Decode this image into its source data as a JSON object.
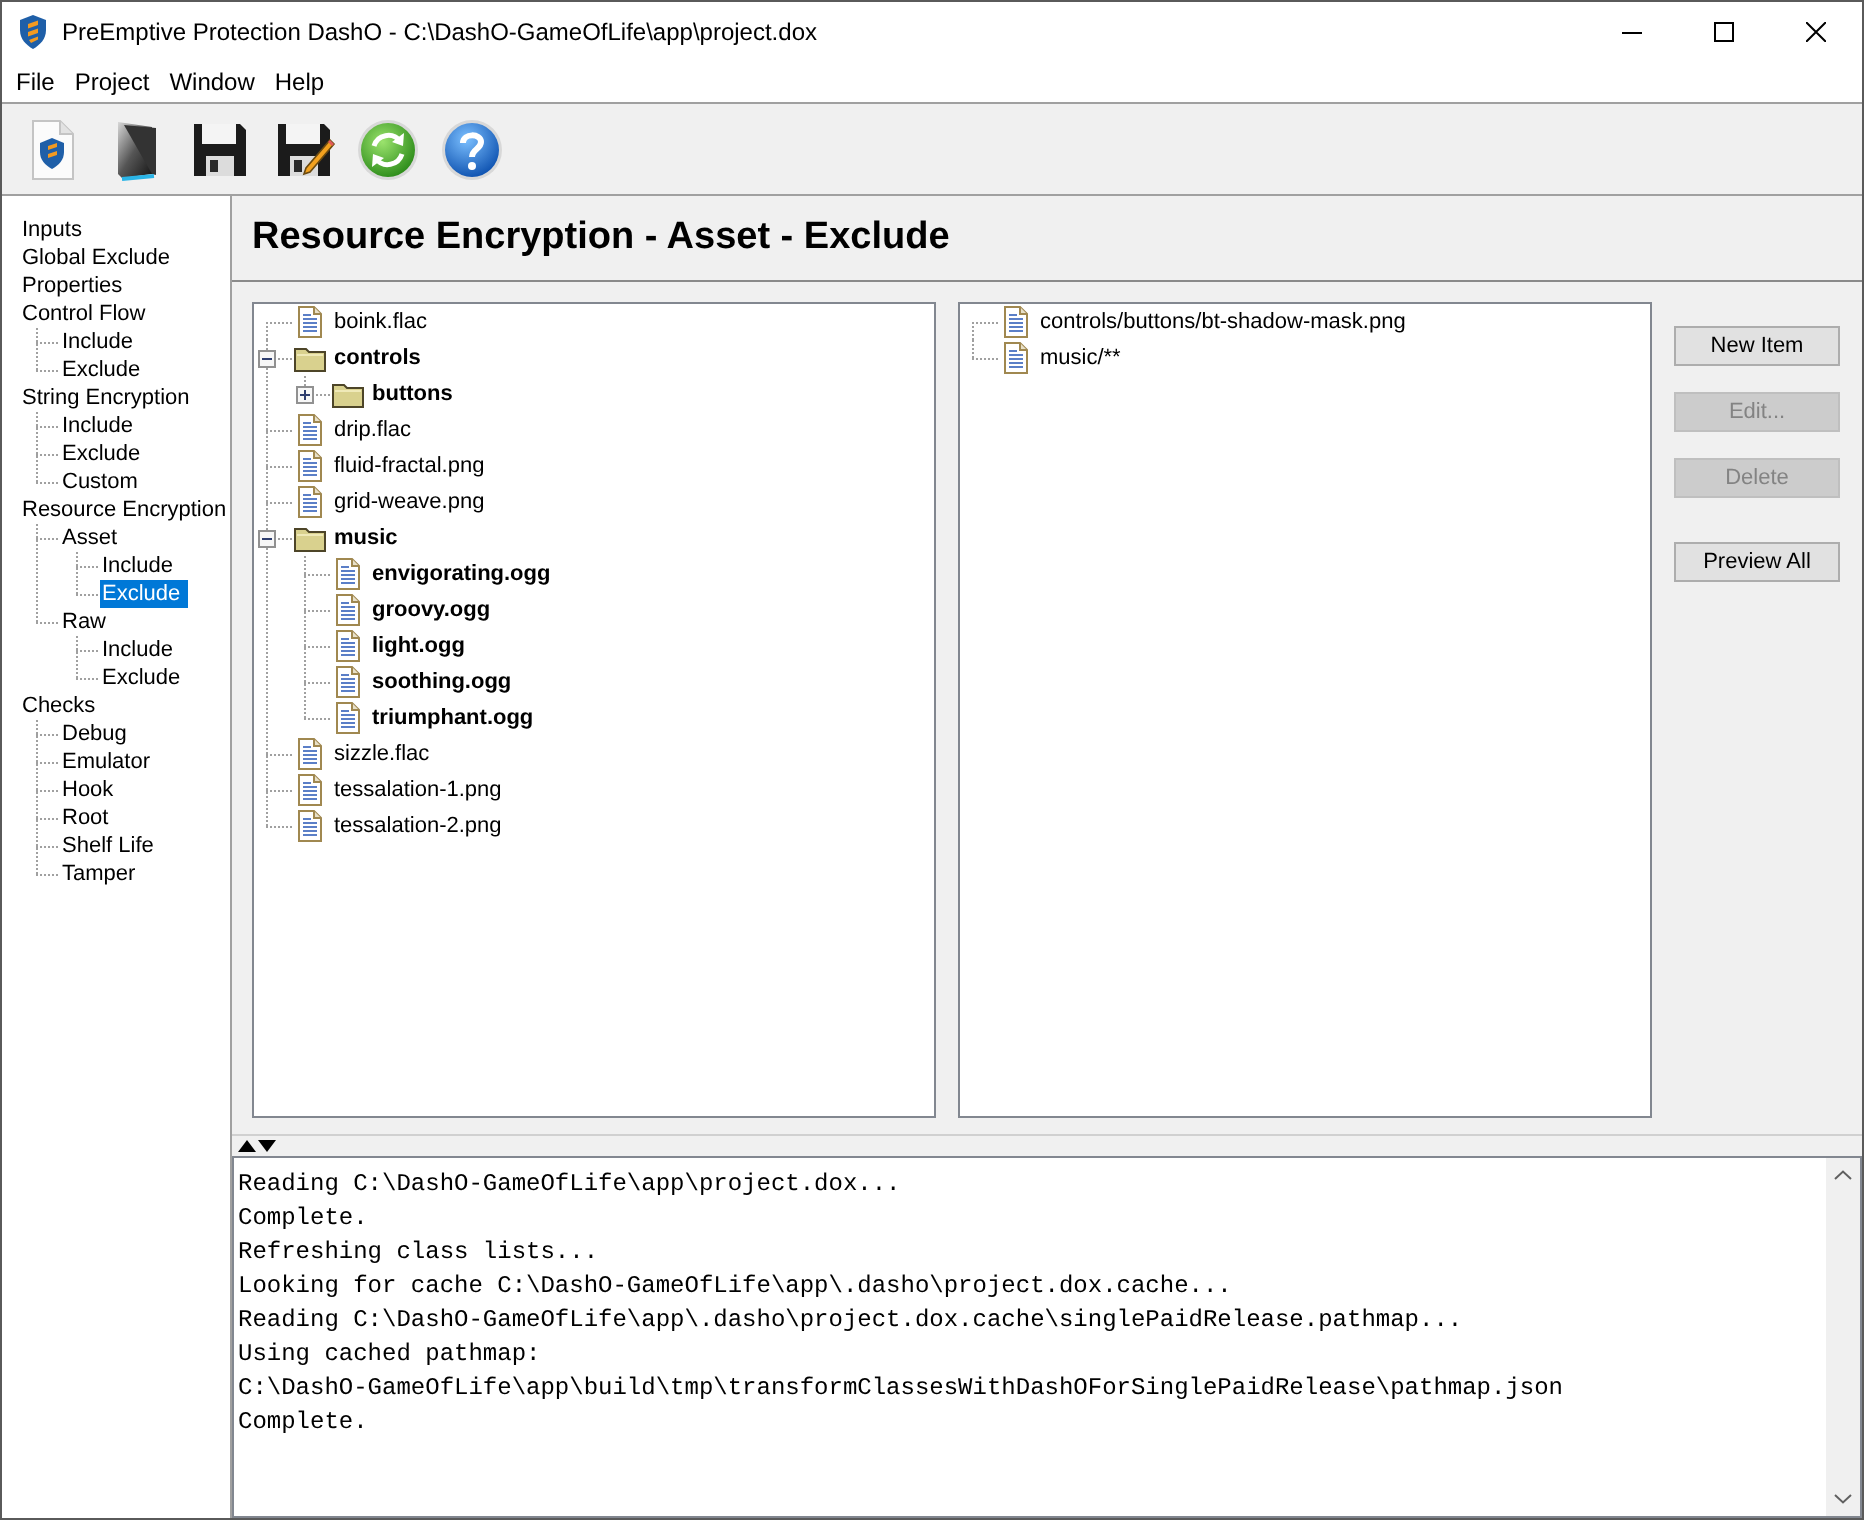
{
  "window": {
    "title": "PreEmptive Protection DashO - C:\\DashO-GameOfLife\\app\\project.dox"
  },
  "menu": [
    "File",
    "Project",
    "Window",
    "Help"
  ],
  "sidebar": {
    "items": [
      {
        "label": "Inputs",
        "selected": false
      },
      {
        "label": "Global Exclude",
        "selected": false
      },
      {
        "label": "Properties",
        "selected": false
      },
      {
        "label": "Control Flow",
        "selected": false,
        "children": [
          {
            "label": "Include",
            "selected": false
          },
          {
            "label": "Exclude",
            "selected": false
          }
        ]
      },
      {
        "label": "String Encryption",
        "selected": false,
        "children": [
          {
            "label": "Include",
            "selected": false
          },
          {
            "label": "Exclude",
            "selected": false
          },
          {
            "label": "Custom",
            "selected": false
          }
        ]
      },
      {
        "label": "Resource Encryption",
        "selected": false,
        "children": [
          {
            "label": "Asset",
            "selected": false,
            "children": [
              {
                "label": "Include",
                "selected": false
              },
              {
                "label": "Exclude",
                "selected": true
              }
            ]
          },
          {
            "label": "Raw",
            "selected": false,
            "children": [
              {
                "label": "Include",
                "selected": false
              },
              {
                "label": "Exclude",
                "selected": false
              }
            ]
          }
        ]
      },
      {
        "label": "Checks",
        "selected": false,
        "children": [
          {
            "label": "Debug",
            "selected": false
          },
          {
            "label": "Emulator",
            "selected": false
          },
          {
            "label": "Hook",
            "selected": false
          },
          {
            "label": "Root",
            "selected": false
          },
          {
            "label": "Shelf Life",
            "selected": false
          },
          {
            "label": "Tamper",
            "selected": false
          }
        ]
      }
    ]
  },
  "page_title": "Resource Encryption - Asset - Exclude",
  "resource_tree": {
    "items": [
      {
        "kind": "file",
        "label": "boink.flac",
        "matched": false
      },
      {
        "kind": "folder",
        "label": "controls",
        "matched": true,
        "expanded": true,
        "children": [
          {
            "kind": "folder",
            "label": "buttons",
            "matched": true,
            "expanded": false
          }
        ]
      },
      {
        "kind": "file",
        "label": "drip.flac",
        "matched": false
      },
      {
        "kind": "file",
        "label": "fluid-fractal.png",
        "matched": false
      },
      {
        "kind": "file",
        "label": "grid-weave.png",
        "matched": false
      },
      {
        "kind": "folder",
        "label": "music",
        "matched": true,
        "expanded": true,
        "children": [
          {
            "kind": "file",
            "label": "envigorating.ogg",
            "matched": true
          },
          {
            "kind": "file",
            "label": "groovy.ogg",
            "matched": true
          },
          {
            "kind": "file",
            "label": "light.ogg",
            "matched": true
          },
          {
            "kind": "file",
            "label": "soothing.ogg",
            "matched": true
          },
          {
            "kind": "file",
            "label": "triumphant.ogg",
            "matched": true
          }
        ]
      },
      {
        "kind": "file",
        "label": "sizzle.flac",
        "matched": false
      },
      {
        "kind": "file",
        "label": "tessalation-1.png",
        "matched": false
      },
      {
        "kind": "file",
        "label": "tessalation-2.png",
        "matched": false
      }
    ]
  },
  "rules": [
    "controls/buttons/bt-shadow-mask.png",
    "music/**"
  ],
  "buttons": [
    {
      "label": "New Item",
      "disabled": false
    },
    {
      "label": "Edit...",
      "disabled": true
    },
    {
      "label": "Delete",
      "disabled": true
    }
  ],
  "preview_button": {
    "label": "Preview All",
    "disabled": false
  },
  "log": {
    "lines": [
      "Reading C:\\DashO-GameOfLife\\app\\project.dox...",
      "Complete.",
      "Refreshing class lists...",
      "Looking for cache C:\\DashO-GameOfLife\\app\\.dasho\\project.dox.cache...",
      "Reading C:\\DashO-GameOfLife\\app\\.dasho\\project.dox.cache\\singlePaidRelease.pathmap...",
      "Using cached pathmap:",
      "C:\\DashO-GameOfLife\\app\\build\\tmp\\transformClassesWithDashOForSinglePaidRelease\\pathmap.json",
      "Complete."
    ]
  }
}
